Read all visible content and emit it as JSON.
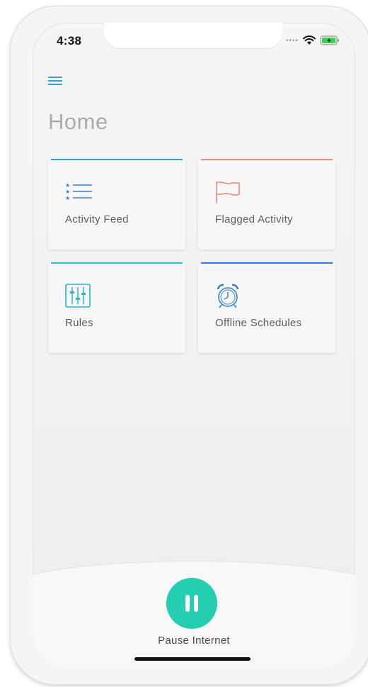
{
  "status_bar": {
    "time": "4:38",
    "signal_icon": "signal-dots-icon",
    "wifi_icon": "wifi-icon",
    "battery_icon": "battery-charging-icon"
  },
  "header": {
    "menu_icon": "hamburger-menu-icon",
    "title": "Home"
  },
  "cards": [
    {
      "label": "Activity Feed",
      "icon": "star-list-icon",
      "accent": "#2f9fe0"
    },
    {
      "label": "Flagged Activity",
      "icon": "flag-icon",
      "accent": "#f08a86"
    },
    {
      "label": "Rules",
      "icon": "sliders-icon",
      "accent": "#2cc4cf"
    },
    {
      "label": "Offline Schedules",
      "icon": "alarm-clock-icon",
      "accent": "#3b78e0"
    }
  ],
  "bottom": {
    "pause_icon": "pause-icon",
    "pause_label": "Pause Internet",
    "pause_color": "#24cfb1"
  }
}
